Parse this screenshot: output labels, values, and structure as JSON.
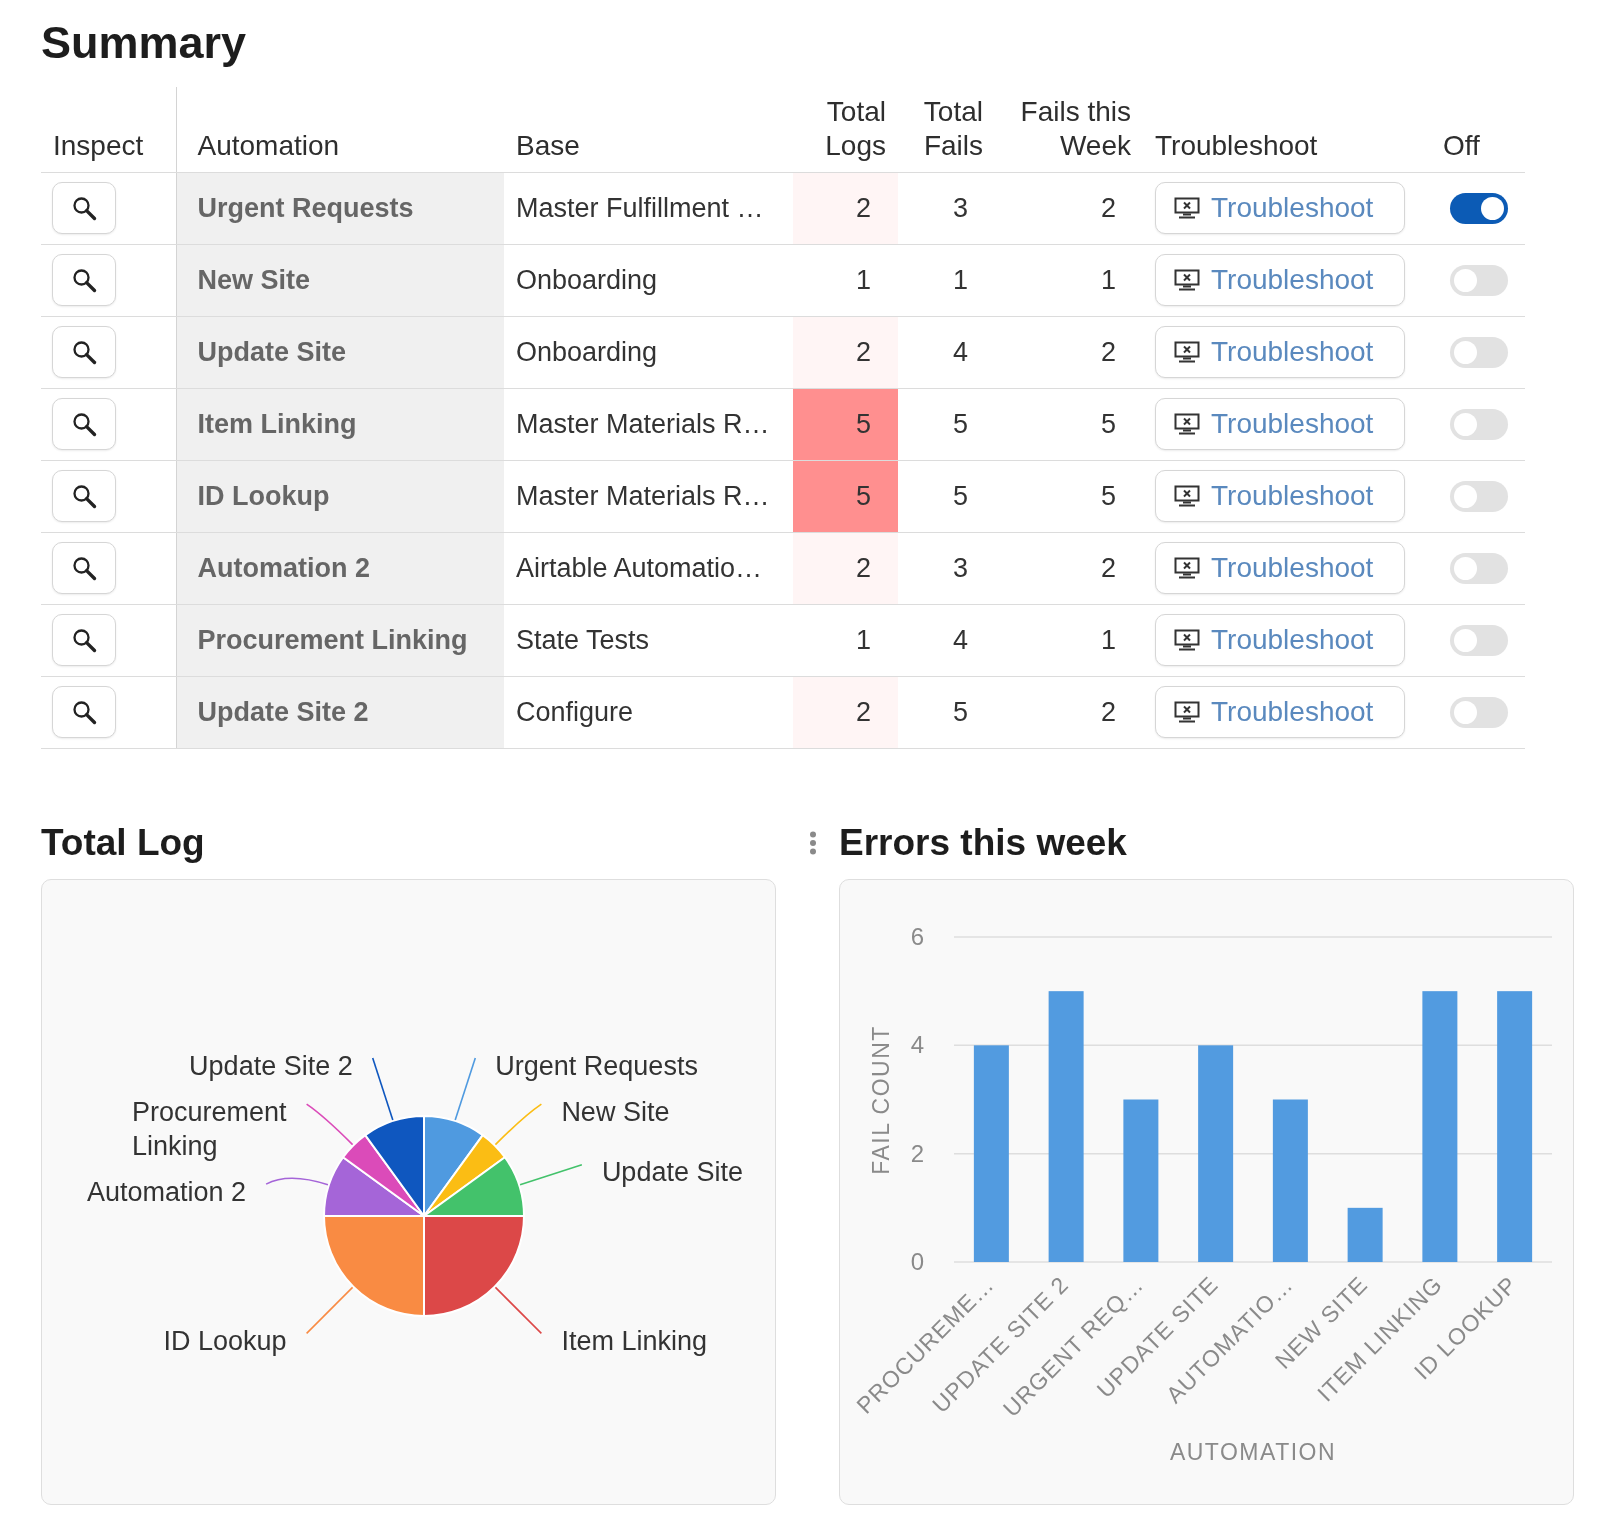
{
  "title": "Summary",
  "table": {
    "columns": [
      "Inspect",
      "Automation",
      "Base",
      "Total Logs",
      "Total Fails",
      "Fails this Week",
      "Troubleshoot",
      "Off"
    ],
    "rows": [
      {
        "automation": "Urgent Requests",
        "base": "Master Fulfillment …",
        "total_logs": {
          "text": "2",
          "color": "#fff5f5"
        },
        "total_fails": "3",
        "fails_this_week": "2",
        "troubleshoot": "Troubleshoot",
        "switch_on": true
      },
      {
        "automation": "New Site",
        "base": "Onboarding",
        "total_logs": {
          "text": "1",
          "color": "#ffffff"
        },
        "total_fails": "1",
        "fails_this_week": "1",
        "troubleshoot": "Troubleshoot",
        "switch_on": false
      },
      {
        "automation": "Update Site",
        "base": "Onboarding",
        "total_logs": {
          "text": "2",
          "color": "#fff5f5"
        },
        "total_fails": "4",
        "fails_this_week": "2",
        "troubleshoot": "Troubleshoot",
        "switch_on": false
      },
      {
        "automation": "Item Linking",
        "base": "Master Materials R…",
        "total_logs": {
          "text": "5",
          "color": "#ff8f8f"
        },
        "total_fails": "5",
        "fails_this_week": "5",
        "troubleshoot": "Troubleshoot",
        "switch_on": false
      },
      {
        "automation": "ID Lookup",
        "base": "Master Materials R…",
        "total_logs": {
          "text": "5",
          "color": "#ff8f8f"
        },
        "total_fails": "5",
        "fails_this_week": "5",
        "troubleshoot": "Troubleshoot",
        "switch_on": false
      },
      {
        "automation": "Automation 2",
        "base": "Airtable Automatio…",
        "total_logs": {
          "text": "2",
          "color": "#fff5f5"
        },
        "total_fails": "3",
        "fails_this_week": "2",
        "troubleshoot": "Troubleshoot",
        "switch_on": false
      },
      {
        "automation": "Procurement Linking",
        "base": "State Tests",
        "total_logs": {
          "text": "1",
          "color": "#ffffff"
        },
        "total_fails": "4",
        "fails_this_week": "1",
        "troubleshoot": "Troubleshoot",
        "switch_on": false
      },
      {
        "automation": "Update Site 2",
        "base": "Configure",
        "total_logs": {
          "text": "2",
          "color": "#fff5f5"
        },
        "total_fails": "5",
        "fails_this_week": "2",
        "troubleshoot": "Troubleshoot",
        "switch_on": false
      }
    ]
  },
  "panels": [
    {
      "title": "Total Log",
      "handle": false,
      "chart_data": {
        "type": "pie",
        "categories": [
          "Urgent Requests",
          "New Site",
          "Update Site",
          "Item Linking",
          "ID Lookup",
          "Automation 2",
          "Procurement Linking",
          "Update Site 2"
        ],
        "values": [
          2,
          1,
          2,
          5,
          5,
          2,
          1,
          2
        ],
        "colors": [
          "#4f9ae0",
          "#fbbd14",
          "#43c26b",
          "#dc4848",
          "#f98b43",
          "#a565d8",
          "#db4bb9",
          "#0f57bf"
        ]
      }
    },
    {
      "title": "Errors this week",
      "handle": true,
      "chart_data": {
        "type": "bar",
        "xlabel": "AUTOMATION",
        "ylabel": "FAIL COUNT",
        "categories": [
          "PROCUREME…",
          "UPDATE SITE 2",
          "URGENT REQ…",
          "UPDATE SITE",
          "AUTOMATIO…",
          "NEW SITE",
          "ITEM LINKING",
          "ID LOOKUP"
        ],
        "series": [
          {
            "color": "#529be0",
            "values": [
              4,
              5,
              3,
              4,
              3,
              1,
              5,
              5
            ]
          }
        ],
        "ylim": [
          0,
          6
        ],
        "yticks": [
          0,
          2,
          4,
          6
        ]
      }
    }
  ]
}
